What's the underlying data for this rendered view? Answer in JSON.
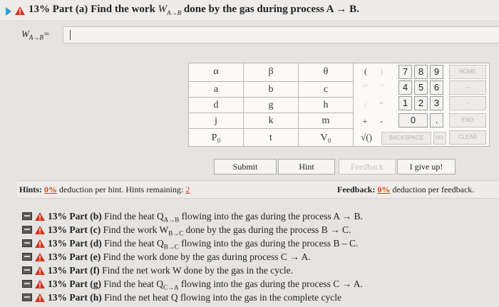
{
  "header": {
    "percent": "13%",
    "part": "Part (a)",
    "text_before": "Find the work",
    "symbol": "W",
    "subscript": "A→B",
    "text_after": "done by the gas during process A → B."
  },
  "answer": {
    "symbol": "W",
    "subscript": "A→B",
    "equals": "=",
    "value": ""
  },
  "keypad": {
    "symbols": [
      [
        "α",
        "β",
        "θ"
      ],
      [
        "a",
        "b",
        "c"
      ],
      [
        "d",
        "g",
        "h"
      ],
      [
        "j",
        "k",
        "m"
      ],
      [
        "P₀",
        "t",
        "V₀"
      ]
    ],
    "paren_open": "(",
    "paren_close": ")",
    "numbers": [
      [
        "7",
        "8",
        "9"
      ],
      [
        "4",
        "5",
        "6"
      ],
      [
        "1",
        "2",
        "3"
      ]
    ],
    "zero": "0",
    "dot": ".",
    "plus": "+",
    "minus": "-",
    "sqrt": "√()",
    "backspace": "BACKSPACE",
    "del": "DEL",
    "home": "HOME",
    "end": "END",
    "clear": "CLEAR",
    "up_arrow": "↑^",
    "caret_arrow": "^\\",
    "multiply": "*",
    "divide": "/",
    "dash": "—",
    "dash2": "—"
  },
  "buttons": {
    "submit": "Submit",
    "hint": "Hint",
    "feedback": "Feedback",
    "give_up": "I give up!"
  },
  "hints": {
    "label": "Hints:",
    "pct": "0%",
    "text": "deduction per hint. Hints remaining:",
    "remaining": "2"
  },
  "feedback": {
    "label": "Feedback:",
    "pct": "0%",
    "text": "deduction per feedback."
  },
  "parts": [
    {
      "label": "13% Part (b)",
      "text": "Find the heat Q",
      "sub": "A→B",
      "rest": " flowing into the gas during the process A → B."
    },
    {
      "label": "13% Part (c)",
      "text": "Find the work W",
      "sub": "B→C",
      "rest": " done by the gas during the process B → C."
    },
    {
      "label": "13% Part (d)",
      "text": "Find the heat Q",
      "sub": "B→C",
      "rest": " flowing into the gas during the process B – C."
    },
    {
      "label": "13% Part (e)",
      "text": "Find the work done by the gas during process C → A.",
      "sub": "",
      "rest": ""
    },
    {
      "label": "13% Part (f)",
      "text": "Find the net work W done by the gas in the cycle.",
      "sub": "",
      "rest": ""
    },
    {
      "label": "13% Part (g)",
      "text": "Find the heat Q",
      "sub": "C→A",
      "rest": " flowing into the gas during the process C → A."
    },
    {
      "label": "13% Part (h)",
      "text": "Find the net heat Q flowing into the gas in the complete cycle",
      "sub": "",
      "rest": ""
    }
  ],
  "colors": {
    "accent_blue": "#2f9bd6",
    "warning_fill": "#d3341f",
    "link_orange": "#d04a12"
  }
}
